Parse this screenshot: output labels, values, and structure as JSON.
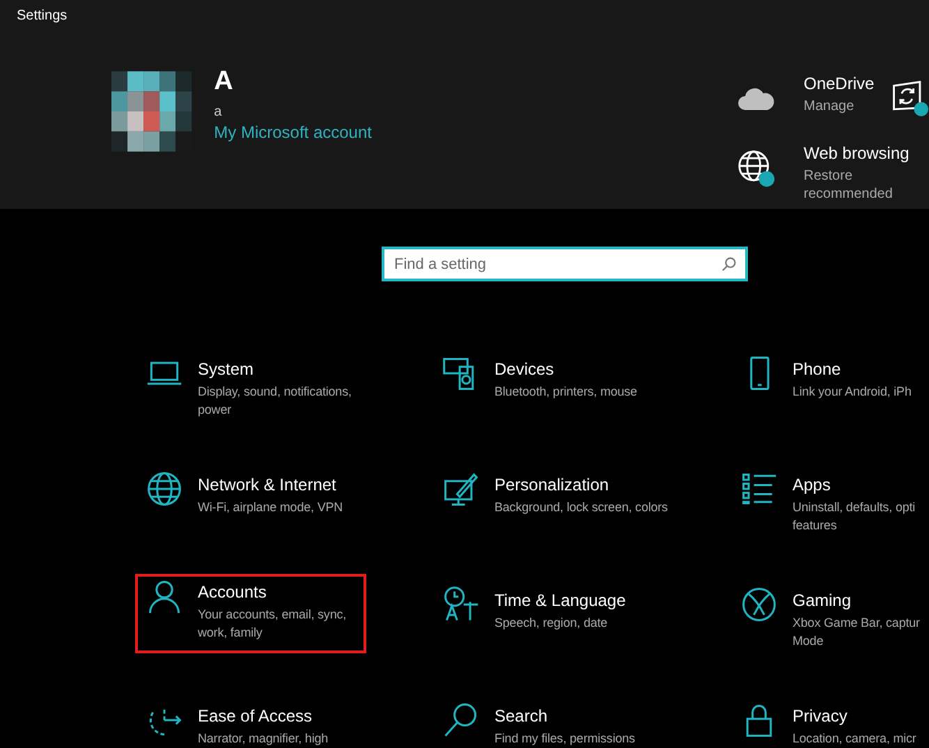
{
  "window": {
    "title": "Settings"
  },
  "account": {
    "name": "A",
    "email": "a",
    "link": "My Microsoft account"
  },
  "quick_links": [
    {
      "title": "OneDrive",
      "subtitle": [
        "Manage"
      ]
    },
    {
      "title": "Web browsing",
      "subtitle": [
        "Restore",
        "recommended"
      ]
    }
  ],
  "search": {
    "placeholder": "Find a setting"
  },
  "categories": [
    {
      "title": "System",
      "description": [
        "Display, sound, notifications,",
        "power"
      ],
      "highlighted": false
    },
    {
      "title": "Devices",
      "description": [
        "Bluetooth, printers, mouse"
      ],
      "highlighted": false
    },
    {
      "title": "Phone",
      "description": [
        "Link your Android, iPh"
      ],
      "highlighted": false
    },
    {
      "title": "Network & Internet",
      "description": [
        "Wi-Fi, airplane mode, VPN"
      ],
      "highlighted": false
    },
    {
      "title": "Personalization",
      "description": [
        "Background, lock screen, colors"
      ],
      "highlighted": false
    },
    {
      "title": "Apps",
      "description": [
        "Uninstall, defaults, opti",
        "features"
      ],
      "highlighted": false
    },
    {
      "title": "Accounts",
      "description": [
        "Your accounts, email, sync,",
        "work, family"
      ],
      "highlighted": true
    },
    {
      "title": "Time & Language",
      "description": [
        "Speech, region, date"
      ],
      "highlighted": false
    },
    {
      "title": "Gaming",
      "description": [
        "Xbox Game Bar, captur",
        "Mode"
      ],
      "highlighted": false
    },
    {
      "title": "Ease of Access",
      "description": [
        "Narrator, magnifier, high"
      ],
      "highlighted": false
    },
    {
      "title": "Search",
      "description": [
        "Find my files, permissions"
      ],
      "highlighted": false
    },
    {
      "title": "Privacy",
      "description": [
        "Location, camera, micr"
      ],
      "highlighted": false
    }
  ]
}
